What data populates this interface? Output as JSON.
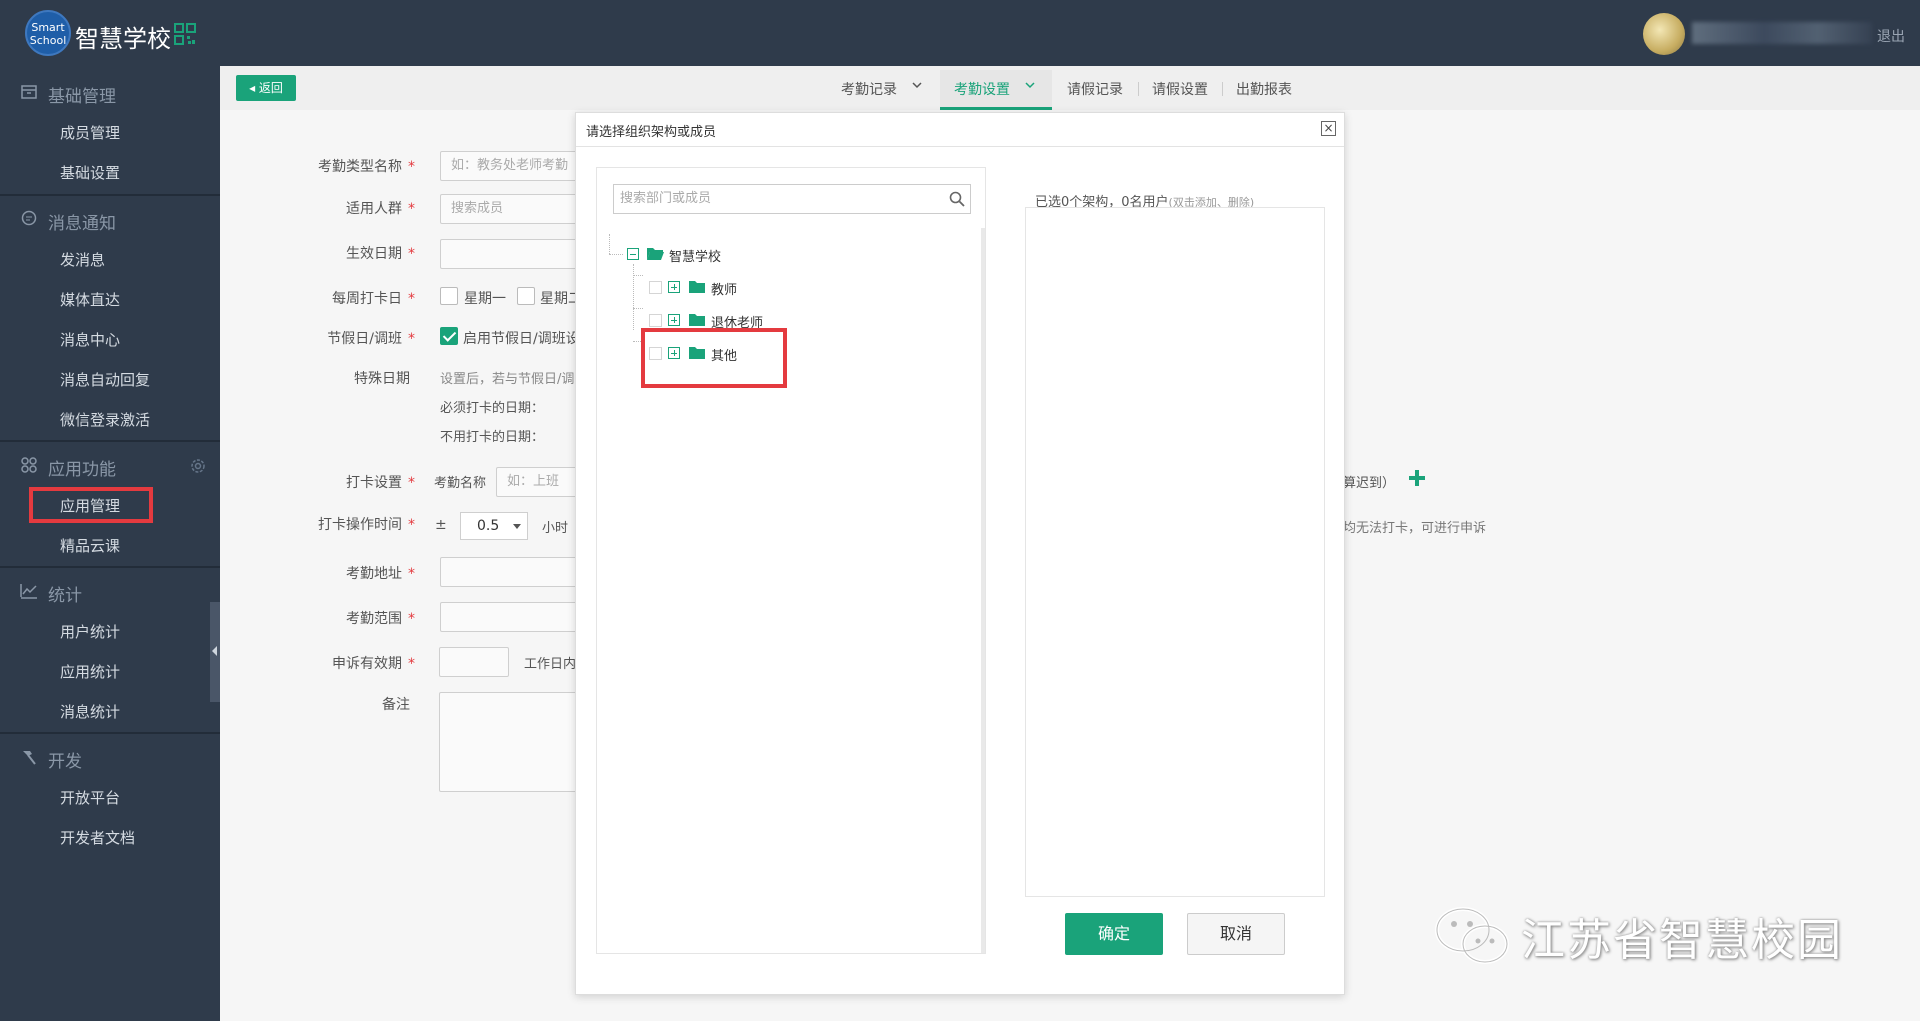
{
  "header": {
    "logo_line1": "Smart",
    "logo_line2": "School",
    "app_title": "智慧学校",
    "logout": "退出"
  },
  "sidebar": {
    "sections": [
      {
        "label": "基础管理",
        "icon": "archive-icon",
        "items": [
          "成员管理",
          "基础设置"
        ]
      },
      {
        "label": "消息通知",
        "icon": "chat-bubble-icon",
        "items": [
          "发消息",
          "媒体直达",
          "消息中心",
          "消息自动回复",
          "微信登录激活"
        ]
      },
      {
        "label": "应用功能",
        "icon": "apps-grid-icon",
        "items": [
          "应用管理",
          "精品云课"
        ]
      },
      {
        "label": "统计",
        "icon": "line-chart-icon",
        "items": [
          "用户统计",
          "应用统计",
          "消息统计"
        ]
      },
      {
        "label": "开发",
        "icon": "hammer-icon",
        "items": [
          "开放平台",
          "开发者文档"
        ]
      }
    ]
  },
  "toolbar": {
    "back_label": "返回"
  },
  "tabs": [
    {
      "label": "考勤记录",
      "has_dropdown": true,
      "active": false
    },
    {
      "label": "考勤设置",
      "has_dropdown": true,
      "active": true
    },
    {
      "label": "请假记录",
      "active": false
    },
    {
      "label": "请假设置",
      "active": false
    },
    {
      "label": "出勤报表",
      "active": false
    }
  ],
  "form": {
    "type_name_label": "考勤类型名称",
    "type_name_placeholder": "如：教务处老师考勤",
    "audience_label": "适用人群",
    "audience_placeholder": "搜索成员",
    "effective_date_label": "生效日期",
    "weekly_label": "每周打卡日",
    "weekday1": "星期一",
    "weekday2": "星期二",
    "holiday_label": "节假日/调班",
    "holiday_option": "启用节假日/调班设",
    "special_label": "特殊日期",
    "special_desc": "设置后，若与节假日/调",
    "must_date": "必须打卡的日期：",
    "no_date": "不用打卡的日期：",
    "punch_label": "打卡设置",
    "punch_name_label": "考勤名称",
    "punch_name_placeholder": "如：上班",
    "punch_late_text": "算迟到）",
    "op_time_label": "打卡操作时间",
    "plus_minus": "±",
    "op_time_value": "0.5",
    "hour_unit": "小时",
    "op_time_note": "均无法打卡，可进行申诉",
    "address_label": "考勤地址",
    "range_label": "考勤范围",
    "appeal_label": "申诉有效期",
    "appeal_unit": "工作日内",
    "remark_label": "备注"
  },
  "dialog": {
    "title": "请选择组织架构或成员",
    "search_placeholder": "搜索部门或成员",
    "tree": {
      "root": "智慧学校",
      "children": [
        "教师",
        "退休老师",
        "其他"
      ]
    },
    "selected_summary": "已选0个架构，0名用户",
    "selected_hint": "(双击添加、删除)",
    "ok_label": "确定",
    "cancel_label": "取消"
  },
  "watermark": {
    "text": "江苏省智慧校园"
  },
  "colors": {
    "accent": "#1aa37a",
    "sidebar_bg": "#2f3b4b",
    "highlight": "#e43a3f"
  }
}
